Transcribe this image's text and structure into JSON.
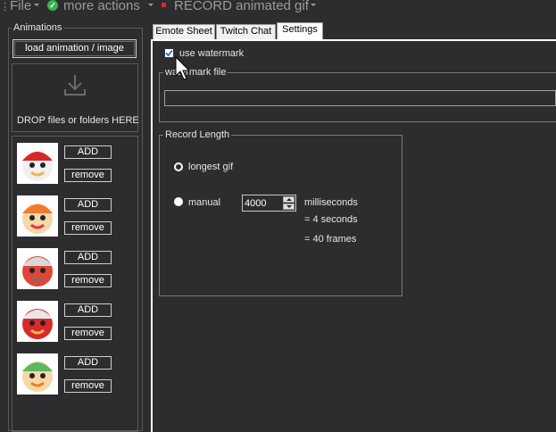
{
  "menubar": {
    "file_label": "File",
    "more_actions_label": "more actions",
    "record_label": "RECORD animated gif"
  },
  "left_panel": {
    "group_title": "Animations",
    "load_button_label": "load animation / image",
    "drop_zone_label": "DROP files or folders HERE",
    "items": [
      {
        "add_label": "ADD",
        "remove_label": "remove"
      },
      {
        "add_label": "ADD",
        "remove_label": "remove"
      },
      {
        "add_label": "ADD",
        "remove_label": "remove"
      },
      {
        "add_label": "ADD",
        "remove_label": "remove"
      },
      {
        "add_label": "ADD",
        "remove_label": "remove"
      }
    ]
  },
  "tabs": [
    {
      "label": "Emote Sheet",
      "active": false
    },
    {
      "label": "Twitch Chat",
      "active": false
    },
    {
      "label": "Settings",
      "active": true
    }
  ],
  "settings": {
    "use_watermark_label": "use watermark",
    "use_watermark_checked": true,
    "watermark_file_title": "watermark file",
    "watermark_file_value": "",
    "record_length_title": "Record Length",
    "longest_gif_label": "longest gif",
    "longest_gif_selected": true,
    "manual_label": "manual",
    "manual_selected": false,
    "manual_value": "4000",
    "milliseconds_label": "milliseconds",
    "seconds_text": "= 4 seconds",
    "frames_text": "= 40 frames"
  },
  "colors": {
    "background": "#2d2d30",
    "record_red": "#e8222c",
    "ok_green": "#3bb44a"
  }
}
